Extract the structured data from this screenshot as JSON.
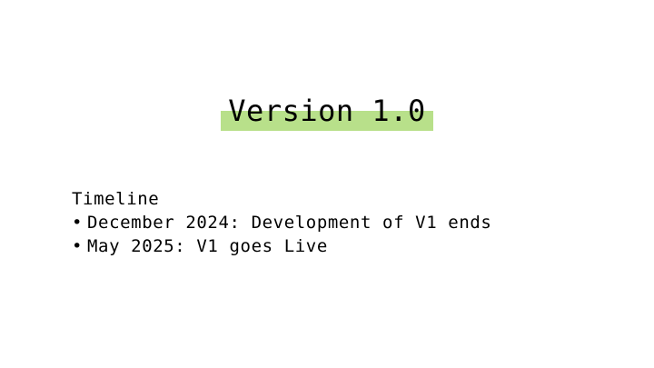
{
  "slide": {
    "title": "Version 1.0",
    "highlight_color": "#b8e08a",
    "heading": "Timeline",
    "bullet_glyph": "•",
    "items": [
      {
        "text": "December 2024: Development of V1 ends"
      },
      {
        "text": "May 2025: V1 goes Live"
      }
    ]
  }
}
